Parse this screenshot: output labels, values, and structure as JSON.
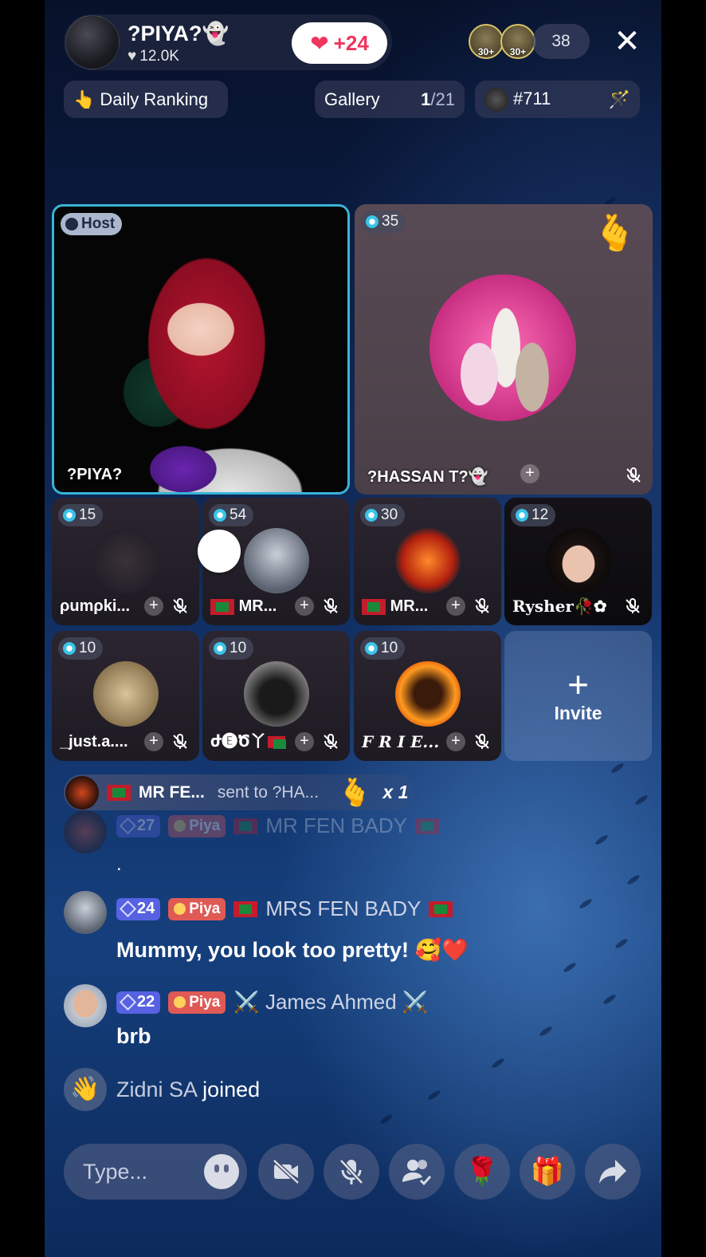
{
  "header": {
    "host_name": "?PIYA?👻",
    "host_likes": "12.0K",
    "like_increment": "+24",
    "viewer_badges": [
      "30+",
      "30+"
    ],
    "viewer_count": "38",
    "close_label": "✕",
    "daily_ranking": "Daily Ranking",
    "gallery_label": "Gallery",
    "gallery_current": "1",
    "gallery_total": "/21",
    "rank": "#711"
  },
  "seats": {
    "host": {
      "badge": "Host",
      "name": "?PIYA?"
    },
    "guest": {
      "count": "35",
      "name": "?HASSAN T?👻"
    },
    "small": [
      {
        "count": "15",
        "name": "ρumρki..."
      },
      {
        "count": "54",
        "name": "MR..."
      },
      {
        "count": "30",
        "name": "MR..."
      },
      {
        "count": "12",
        "name": "Rysher🥀✿"
      },
      {
        "count": "10",
        "name": "_just.a...."
      },
      {
        "count": "10",
        "name": "ժ🅔Ծ丫"
      },
      {
        "count": "10",
        "name": "F R I E..."
      }
    ],
    "invite_label": "Invite"
  },
  "gift_banner": {
    "sender": "MR FE...",
    "sent_to": "sent to ?HA...",
    "multiplier": "x 1"
  },
  "chat": [
    {
      "level": "27",
      "club": "Piya",
      "user": "MR FEN BADY",
      "message": "."
    },
    {
      "level": "24",
      "club": "Piya",
      "user": "MRS FEN BADY",
      "message": "Mummy, you look too pretty! 🥰❤️"
    },
    {
      "level": "22",
      "club": "Piya",
      "user": "⚔️ James Ahmed ⚔️",
      "message": "brb"
    }
  ],
  "joined": {
    "user": "Zidni SA",
    "action": "joined"
  },
  "composer": {
    "placeholder": "Type..."
  },
  "colors": {
    "host_border": "#3ab4d6",
    "level_badge": "#5662e2",
    "club_badge": "#e05a55",
    "like": "#f0355e"
  }
}
